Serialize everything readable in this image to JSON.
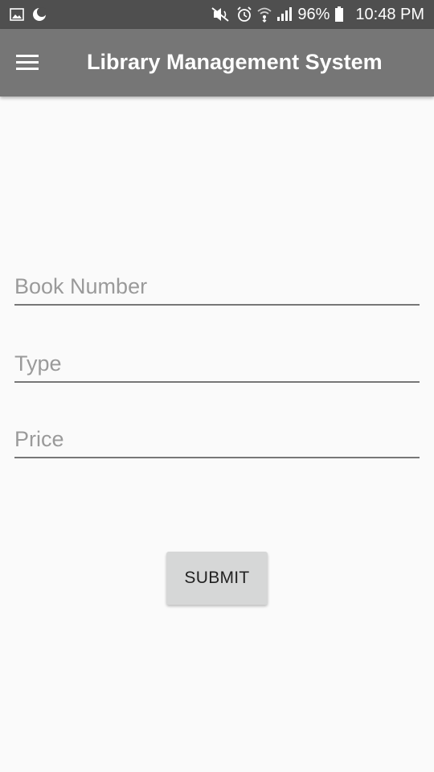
{
  "status_bar": {
    "left_icons": [
      "image-icon",
      "moon-icon"
    ],
    "right_icons": [
      "mute-icon",
      "alarm-icon",
      "wifi-icon",
      "signal-icon",
      "battery-icon"
    ],
    "battery": "96%",
    "time": "10:48 PM"
  },
  "app_bar": {
    "title": "Library Management System",
    "menu_icon": "menu-icon",
    "background": "#767676"
  },
  "form": {
    "book_number_placeholder": "Book Number",
    "book_number_value": "",
    "type_placeholder": "Type",
    "type_value": "",
    "price_placeholder": "Price",
    "price_value": "",
    "submit_label": "SUBMIT"
  },
  "colors": {
    "status_bar": "#4f4f4f",
    "app_bar": "#767676",
    "background": "#fafafa",
    "button": "#d6d7d7"
  }
}
